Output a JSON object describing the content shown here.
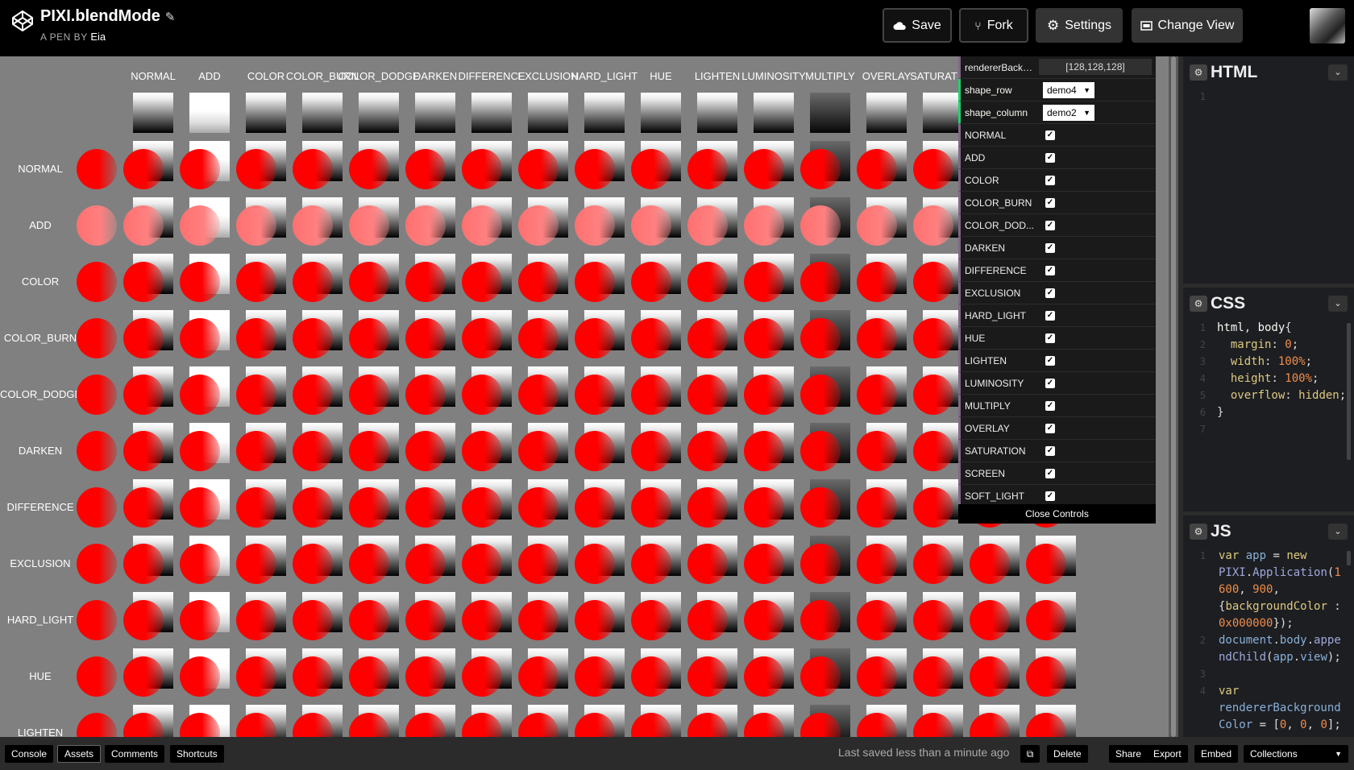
{
  "header": {
    "title": "PIXI.blendMode",
    "pen_by_label": "A PEN BY",
    "author": "Eia",
    "buttons": {
      "save": "Save",
      "fork": "Fork",
      "settings": "Settings",
      "change_view": "Change View"
    }
  },
  "preview": {
    "columns": [
      "NORMAL",
      "ADD",
      "COLOR",
      "COLOR_BURN",
      "COLOR_DODGE",
      "DARKEN",
      "DIFFERENCE",
      "EXCLUSION",
      "HARD_LIGHT",
      "HUE",
      "LIGHTEN",
      "LUMINOSITY",
      "MULTIPLY",
      "OVERLAY",
      "SATURATION"
    ],
    "rows": [
      "NORMAL",
      "ADD",
      "COLOR",
      "COLOR_BURN",
      "COLOR_DODGE",
      "DARKEN",
      "DIFFERENCE",
      "EXCLUSION",
      "HARD_LIGHT",
      "HUE",
      "LIGHTEN"
    ]
  },
  "gui": {
    "renderer_label": "rendererBackg...",
    "renderer_value": "[128,128,128]",
    "shape_row_label": "shape_row",
    "shape_row_value": "demo4",
    "shape_column_label": "shape_column",
    "shape_column_value": "demo2",
    "toggles": [
      "NORMAL",
      "ADD",
      "COLOR",
      "COLOR_BURN",
      "COLOR_DOD...",
      "DARKEN",
      "DIFFERENCE",
      "EXCLUSION",
      "HARD_LIGHT",
      "HUE",
      "LIGHTEN",
      "LUMINOSITY",
      "MULTIPLY",
      "OVERLAY",
      "SATURATION",
      "SCREEN",
      "SOFT_LIGHT"
    ],
    "close_label": "Close Controls"
  },
  "editors": {
    "html": {
      "title": "HTML"
    },
    "css": {
      "title": "CSS"
    },
    "js": {
      "title": "JS"
    }
  },
  "footer": {
    "console": "Console",
    "assets": "Assets",
    "comments": "Comments",
    "shortcuts": "Shortcuts",
    "status": "Last saved less than a minute ago",
    "delete": "Delete",
    "share": "Share",
    "export": "Export",
    "embed": "Embed",
    "collections": "Collections"
  },
  "colors": {
    "preview_bg": "#808080",
    "disc_red": "#ff0000",
    "gui_bg": "#1a1a1a",
    "editor_bg": "#1d1e22"
  }
}
